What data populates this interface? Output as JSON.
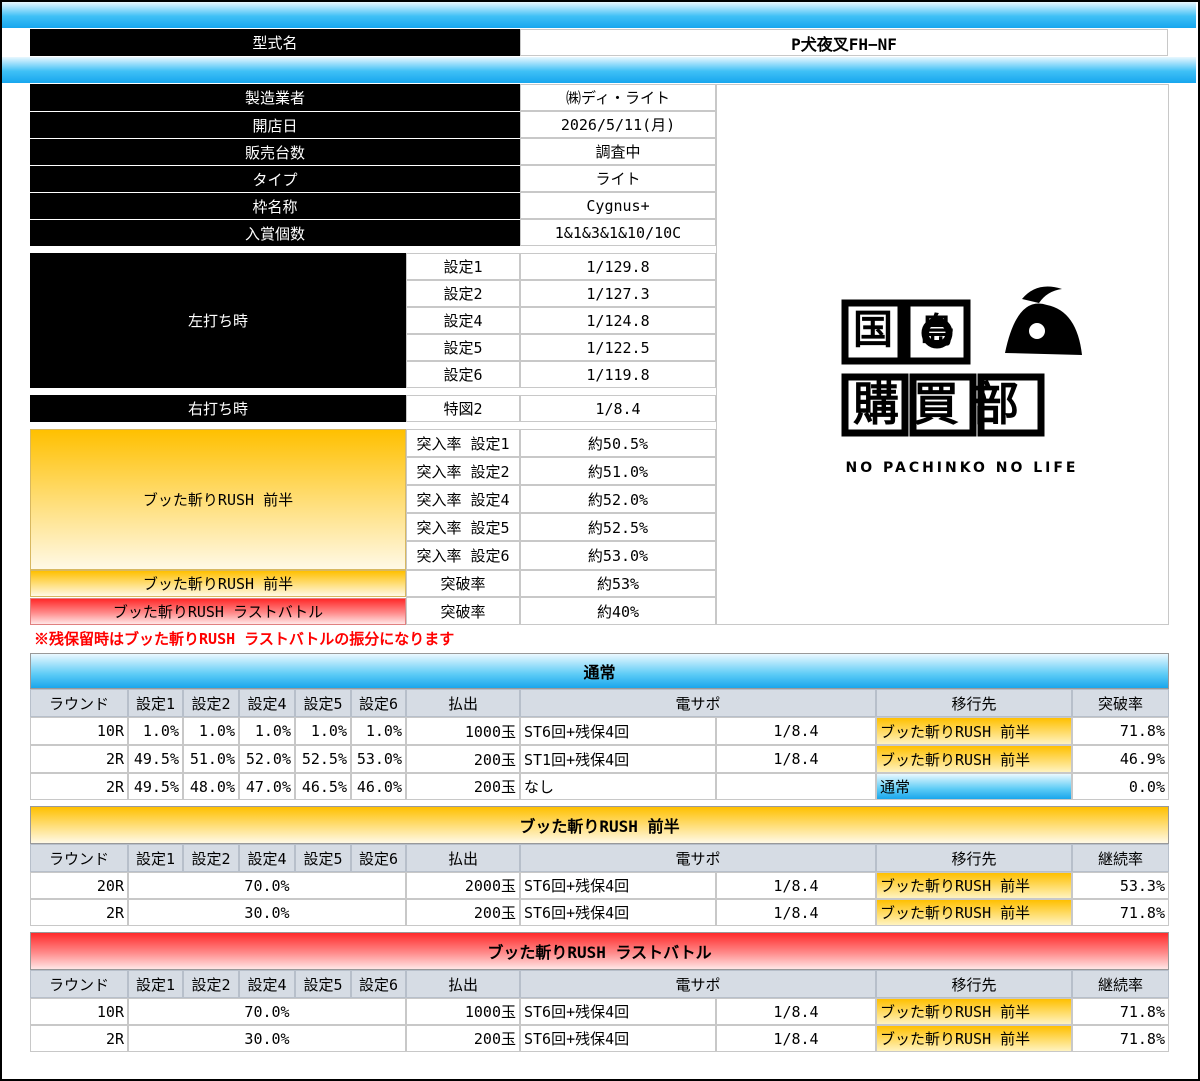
{
  "model": {
    "label": "型式名",
    "value": "P犬夜叉FH−NF"
  },
  "specs": [
    {
      "label": "製造業者",
      "value": "㈱ディ・ライト"
    },
    {
      "label": "開店日",
      "value": "2026/5/11(月)"
    },
    {
      "label": "販売台数",
      "value": "調査中"
    },
    {
      "label": "タイプ",
      "value": "ライト"
    },
    {
      "label": "枠名称",
      "value": "Cygnus+"
    },
    {
      "label": "入賞個数",
      "value": "1&1&3&1&10/10C"
    }
  ],
  "left_play": {
    "label": "左打ち時",
    "rows": [
      {
        "setting": "設定1",
        "value": "1/129.8"
      },
      {
        "setting": "設定2",
        "value": "1/127.3"
      },
      {
        "setting": "設定4",
        "value": "1/124.8"
      },
      {
        "setting": "設定5",
        "value": "1/122.5"
      },
      {
        "setting": "設定6",
        "value": "1/119.8"
      }
    ]
  },
  "right_play": {
    "label": "右打ち時",
    "setting": "特図2",
    "value": "1/8.4"
  },
  "rush_entry": {
    "label": "ブッた斬りRUSH 前半",
    "rows": [
      {
        "setting": "突入率 設定1",
        "value": "約50.5%"
      },
      {
        "setting": "突入率 設定2",
        "value": "約51.0%"
      },
      {
        "setting": "突入率 設定4",
        "value": "約52.0%"
      },
      {
        "setting": "突入率 設定5",
        "value": "約52.5%"
      },
      {
        "setting": "突入率 設定6",
        "value": "約53.0%"
      }
    ]
  },
  "breakthrough": [
    {
      "label": "ブッた斬りRUSH 前半",
      "setting": "突破率",
      "value": "約53%"
    },
    {
      "label": "ブッた斬りRUSH ラストバトル",
      "setting": "突破率",
      "value": "約40%"
    }
  ],
  "note": "※残保留時はブッた斬りRUSH ラストバトルの振分になります",
  "logo": {
    "line1a": "島",
    "line1b": "国",
    "line2": "購買部",
    "tagline": "NO PACHINKO NO LIFE"
  },
  "table_normal": {
    "title": "通常",
    "headers": [
      "ラウンド",
      "設定1",
      "設定2",
      "設定4",
      "設定5",
      "設定6",
      "払出",
      "電サポ",
      "移行先",
      "突破率"
    ],
    "rows": [
      {
        "round": "10R",
        "s1": "1.0%",
        "s2": "1.0%",
        "s4": "1.0%",
        "s5": "1.0%",
        "s6": "1.0%",
        "payout": "1000玉",
        "support": "ST6回+残保4回",
        "prob": "1/8.4",
        "dest": "ブッた斬りRUSH 前半",
        "rate": "71.8%"
      },
      {
        "round": "2R",
        "s1": "49.5%",
        "s2": "51.0%",
        "s4": "52.0%",
        "s5": "52.5%",
        "s6": "53.0%",
        "payout": "200玉",
        "support": "ST1回+残保4回",
        "prob": "1/8.4",
        "dest": "ブッた斬りRUSH 前半",
        "rate": "46.9%"
      },
      {
        "round": "2R",
        "s1": "49.5%",
        "s2": "48.0%",
        "s4": "47.0%",
        "s5": "46.5%",
        "s6": "46.0%",
        "payout": "200玉",
        "support": "なし",
        "prob": "",
        "dest": "通常",
        "rate": "0.0%"
      }
    ]
  },
  "table_first": {
    "title": "ブッた斬りRUSH 前半",
    "headers": [
      "ラウンド",
      "設定1",
      "設定2",
      "設定4",
      "設定5",
      "設定6",
      "払出",
      "電サポ",
      "移行先",
      "継続率"
    ],
    "rows": [
      {
        "round": "20R",
        "share": "70.0%",
        "payout": "2000玉",
        "support": "ST6回+残保4回",
        "prob": "1/8.4",
        "dest": "ブッた斬りRUSH 前半",
        "rate": "53.3%"
      },
      {
        "round": "2R",
        "share": "30.0%",
        "payout": "200玉",
        "support": "ST6回+残保4回",
        "prob": "1/8.4",
        "dest": "ブッた斬りRUSH 前半",
        "rate": "71.8%"
      }
    ]
  },
  "table_last": {
    "title": "ブッた斬りRUSH ラストバトル",
    "headers": [
      "ラウンド",
      "設定1",
      "設定2",
      "設定4",
      "設定5",
      "設定6",
      "払出",
      "電サポ",
      "移行先",
      "継続率"
    ],
    "rows": [
      {
        "round": "10R",
        "share": "70.0%",
        "payout": "1000玉",
        "support": "ST6回+残保4回",
        "prob": "1/8.4",
        "dest": "ブッた斬りRUSH 前半",
        "rate": "71.8%"
      },
      {
        "round": "2R",
        "share": "30.0%",
        "payout": "200玉",
        "support": "ST6回+残保4回",
        "prob": "1/8.4",
        "dest": "ブッた斬りRUSH 前半",
        "rate": "71.8%"
      }
    ]
  },
  "colors": {
    "black": "#000000",
    "gold": "#ffc000",
    "red": "#ff2a2a",
    "blue": "#1aa6ec",
    "note": "#ff0000"
  }
}
